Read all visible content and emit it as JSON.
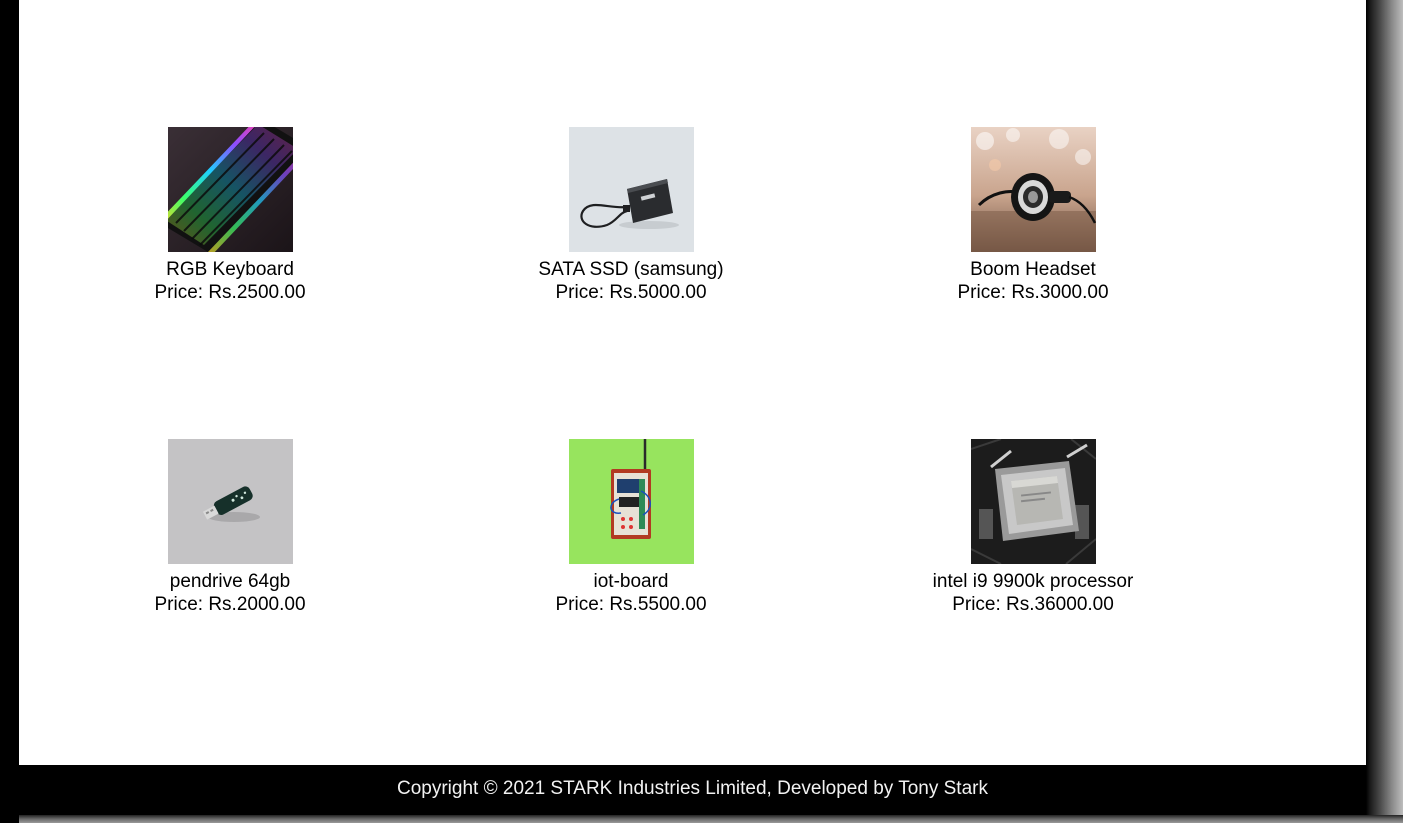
{
  "products": [
    {
      "name": "RGB Keyboard",
      "price_label": "Price:",
      "price": "Rs.2500.00",
      "image": "keyboard-image"
    },
    {
      "name": "SATA SSD (samsung)",
      "price_label": "Price:",
      "price": "Rs.5000.00",
      "image": "ssd-image"
    },
    {
      "name": "Boom Headset",
      "price_label": "Price:",
      "price": "Rs.3000.00",
      "image": "headset-image"
    },
    {
      "name": "pendrive 64gb",
      "price_label": "Price:",
      "price": "Rs.2000.00",
      "image": "pendrive-image"
    },
    {
      "name": "iot-board",
      "price_label": "Price:",
      "price": "Rs.5500.00",
      "image": "iot-board-image"
    },
    {
      "name": "intel i9 9900k processor",
      "price_label": "Price:",
      "price": "Rs.36000.00",
      "image": "processor-image"
    }
  ],
  "footer": {
    "text": "Copyright © 2021 STARK Industries Limited, Developed by Tony Stark"
  }
}
